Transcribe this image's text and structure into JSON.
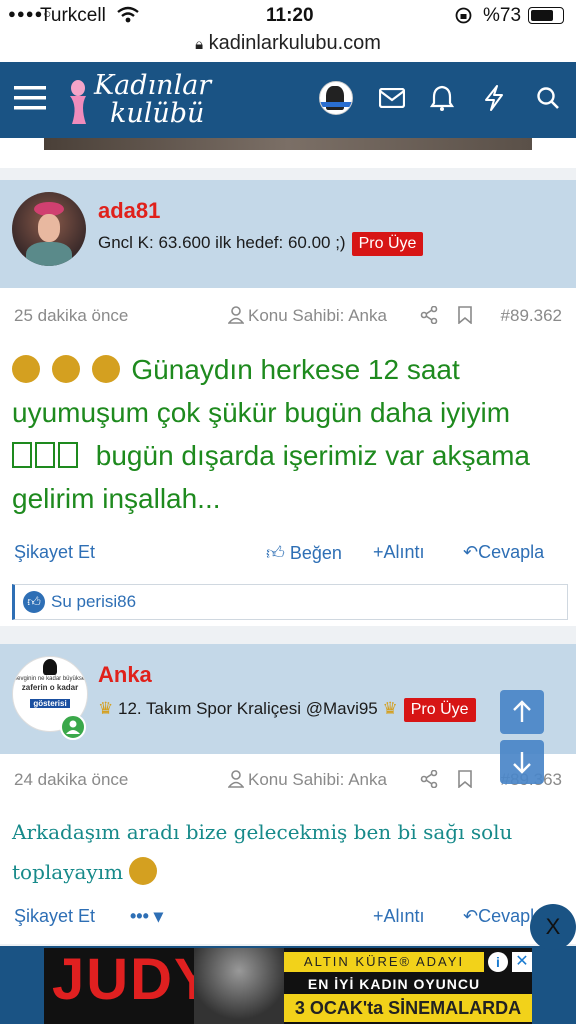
{
  "status_bar": {
    "carrier": "Turkcell",
    "time": "11:20",
    "battery": "%73"
  },
  "browser": {
    "url": "kadinlarkulubu.com"
  },
  "site": {
    "logo_line1": "Kadınlar",
    "logo_line2": "kulübü"
  },
  "posts": [
    {
      "username": "ada81",
      "user_title": "Gncl K: 63.600 ilk hedef: 60.00 ;)",
      "badge": "Pro Üye",
      "time": "25 dakika önce",
      "topic_owner": "Konu Sahibi: Anka",
      "post_number": "#89.362",
      "body_line1": "Günaydın herkese 12 saat",
      "body_line2": "uyumuşum çok şükür bugün daha iyiyim",
      "body_line3": "bugün dışarda işerimiz var akşama",
      "body_line4": "gelirim inşallah...",
      "report": "Şikayet Et",
      "like": "Beğen",
      "quote": "Alıntı",
      "reply": "Cevapla",
      "liked_by": "Su perisi86"
    },
    {
      "username": "Anka",
      "user_title": "12. Takım Spor Kraliçesi @Mavi95",
      "badge": "Pro Üye",
      "time": "24 dakika önce",
      "topic_owner": "Konu Sahibi: Anka",
      "post_number": "#89.363",
      "body_line1": "Arkadaşım aradı bize gelecekmiş ben bi sağı solu",
      "body_line2": "toplayayım",
      "report": "Şikayet Et",
      "quote": "Alıntı",
      "reply": "Cevapla",
      "avatar_text1": "Sevginin ne kadar büyükse,",
      "avatar_text2": "zaferin o kadar",
      "avatar_text3": "gösterisi"
    }
  ],
  "ad": {
    "title": "JUDY",
    "line1": "ALTIN KÜRE® ADAYI",
    "line2": "EN İYİ KADIN OYUNCU",
    "line3": "3 OCAK'ta SİNEMALARDA"
  },
  "close_label": "X",
  "colors": {
    "header": "#1a5384",
    "user_block": "#c4d8e8",
    "username": "#e0211b",
    "post_green": "#1e8a1e",
    "post_teal": "#178a8a",
    "link": "#2e6fb5",
    "badge": "#d71515"
  }
}
